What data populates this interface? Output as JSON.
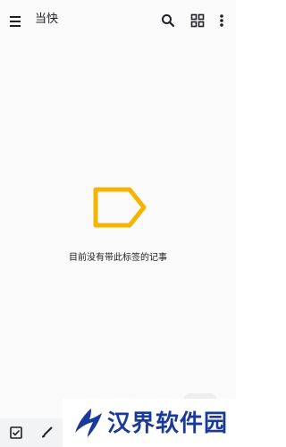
{
  "app_bar": {
    "title": "当快",
    "menu_icon": "hamburger-menu-icon",
    "actions": [
      {
        "icon": "search-icon"
      },
      {
        "icon": "grid-view-icon"
      },
      {
        "icon": "more-vert-icon"
      }
    ]
  },
  "empty_state": {
    "icon": "label-icon",
    "icon_color": "#f4b400",
    "message": "目前没有带此标签的记事"
  },
  "bottom_bar": {
    "items": [
      {
        "icon": "checkbox-icon"
      },
      {
        "icon": "brush-icon"
      }
    ]
  },
  "watermark": {
    "text": "汉界软件园",
    "color": "#1a3a9a"
  }
}
